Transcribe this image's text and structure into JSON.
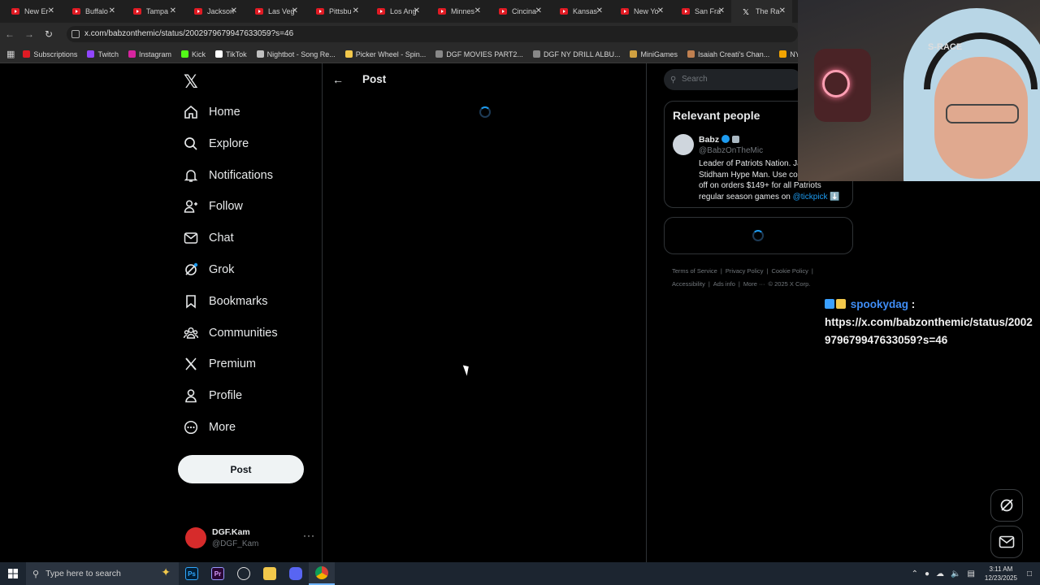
{
  "browser": {
    "tabs": [
      {
        "title": "New Er",
        "icon": "youtube-icon"
      },
      {
        "title": "Buffalo",
        "icon": "youtube-icon"
      },
      {
        "title": "Tampa",
        "icon": "youtube-icon"
      },
      {
        "title": "Jackson",
        "icon": "youtube-icon"
      },
      {
        "title": "Las Veg",
        "icon": "youtube-icon"
      },
      {
        "title": "Pittsbu",
        "icon": "youtube-icon"
      },
      {
        "title": "Los Ang",
        "icon": "youtube-icon"
      },
      {
        "title": "Minnes",
        "icon": "youtube-icon"
      },
      {
        "title": "Cincina",
        "icon": "youtube-icon"
      },
      {
        "title": "Kansas",
        "icon": "youtube-icon"
      },
      {
        "title": "New Yo",
        "icon": "youtube-icon"
      },
      {
        "title": "San Fra",
        "icon": "youtube-icon"
      },
      {
        "title": "The Ra",
        "icon": "x-icon"
      }
    ],
    "url": "x.com/babzonthemic/status/2002979679947633059?s=46",
    "bookmarks": [
      {
        "label": "Subscriptions",
        "color": "#e01b24"
      },
      {
        "label": "Twitch",
        "color": "#9146ff"
      },
      {
        "label": "Instagram",
        "color": "#d6249f"
      },
      {
        "label": "Kick",
        "color": "#53fc18"
      },
      {
        "label": "TikTok",
        "color": "#ffffff"
      },
      {
        "label": "Nightbot - Song Re...",
        "color": "#c0c0c0"
      },
      {
        "label": "Picker Wheel - Spin...",
        "color": "#f2c84b"
      },
      {
        "label": "DGF MOVIES PART2...",
        "color": "#888888"
      },
      {
        "label": "DGF NY DRILL ALBU...",
        "color": "#888888"
      },
      {
        "label": "MiniGames",
        "color": "#d0a040"
      },
      {
        "label": "Isaiah Creati's Chan...",
        "color": "#c08050"
      },
      {
        "label": "NY Drill Deads Quiz...",
        "color": "#f2a400"
      }
    ]
  },
  "nav": {
    "items": [
      {
        "label": "Home",
        "icon": "home-icon"
      },
      {
        "label": "Explore",
        "icon": "search-icon"
      },
      {
        "label": "Notifications",
        "icon": "bell-icon"
      },
      {
        "label": "Follow",
        "icon": "follow-icon"
      },
      {
        "label": "Chat",
        "icon": "mail-icon"
      },
      {
        "label": "Grok",
        "icon": "grok-icon"
      },
      {
        "label": "Bookmarks",
        "icon": "bookmark-icon"
      },
      {
        "label": "Communities",
        "icon": "communities-icon"
      },
      {
        "label": "Premium",
        "icon": "x-icon"
      },
      {
        "label": "Profile",
        "icon": "person-icon"
      },
      {
        "label": "More",
        "icon": "more-circle-icon"
      }
    ],
    "post_label": "Post",
    "account": {
      "name": "DGF.Kam",
      "handle": "@DGF_Kam"
    }
  },
  "main": {
    "title": "Post"
  },
  "sidebar": {
    "search_placeholder": "Search",
    "relevant": {
      "title": "Relevant people",
      "name": "Babz",
      "handle": "@BabzOnTheMic",
      "bio_text": "Leader of Patriots Nation. Jarrett Stidham Hype Man. Use code for $15 off on orders $149+ for all Patriots regular season games on ",
      "bio_link": "@tickpick",
      "bio_emoji": "⬇️"
    },
    "footer": [
      "Terms of Service",
      "|",
      "Privacy Policy",
      "|",
      "Cookie Policy",
      "|",
      "Accessibility",
      "|",
      "Ads info",
      "|",
      "More ···",
      "© 2025 X Corp."
    ]
  },
  "chat_overlay": {
    "username": "spookydag",
    "separator": ":",
    "message": "https://x.com/babzonthemic/status/2002979679947633059?s=46"
  },
  "webcam": {
    "headphone_label": "S-RACE"
  },
  "taskbar": {
    "search_placeholder": "Type here to search",
    "time": "3:11 AM",
    "date": "12/23/2025"
  }
}
